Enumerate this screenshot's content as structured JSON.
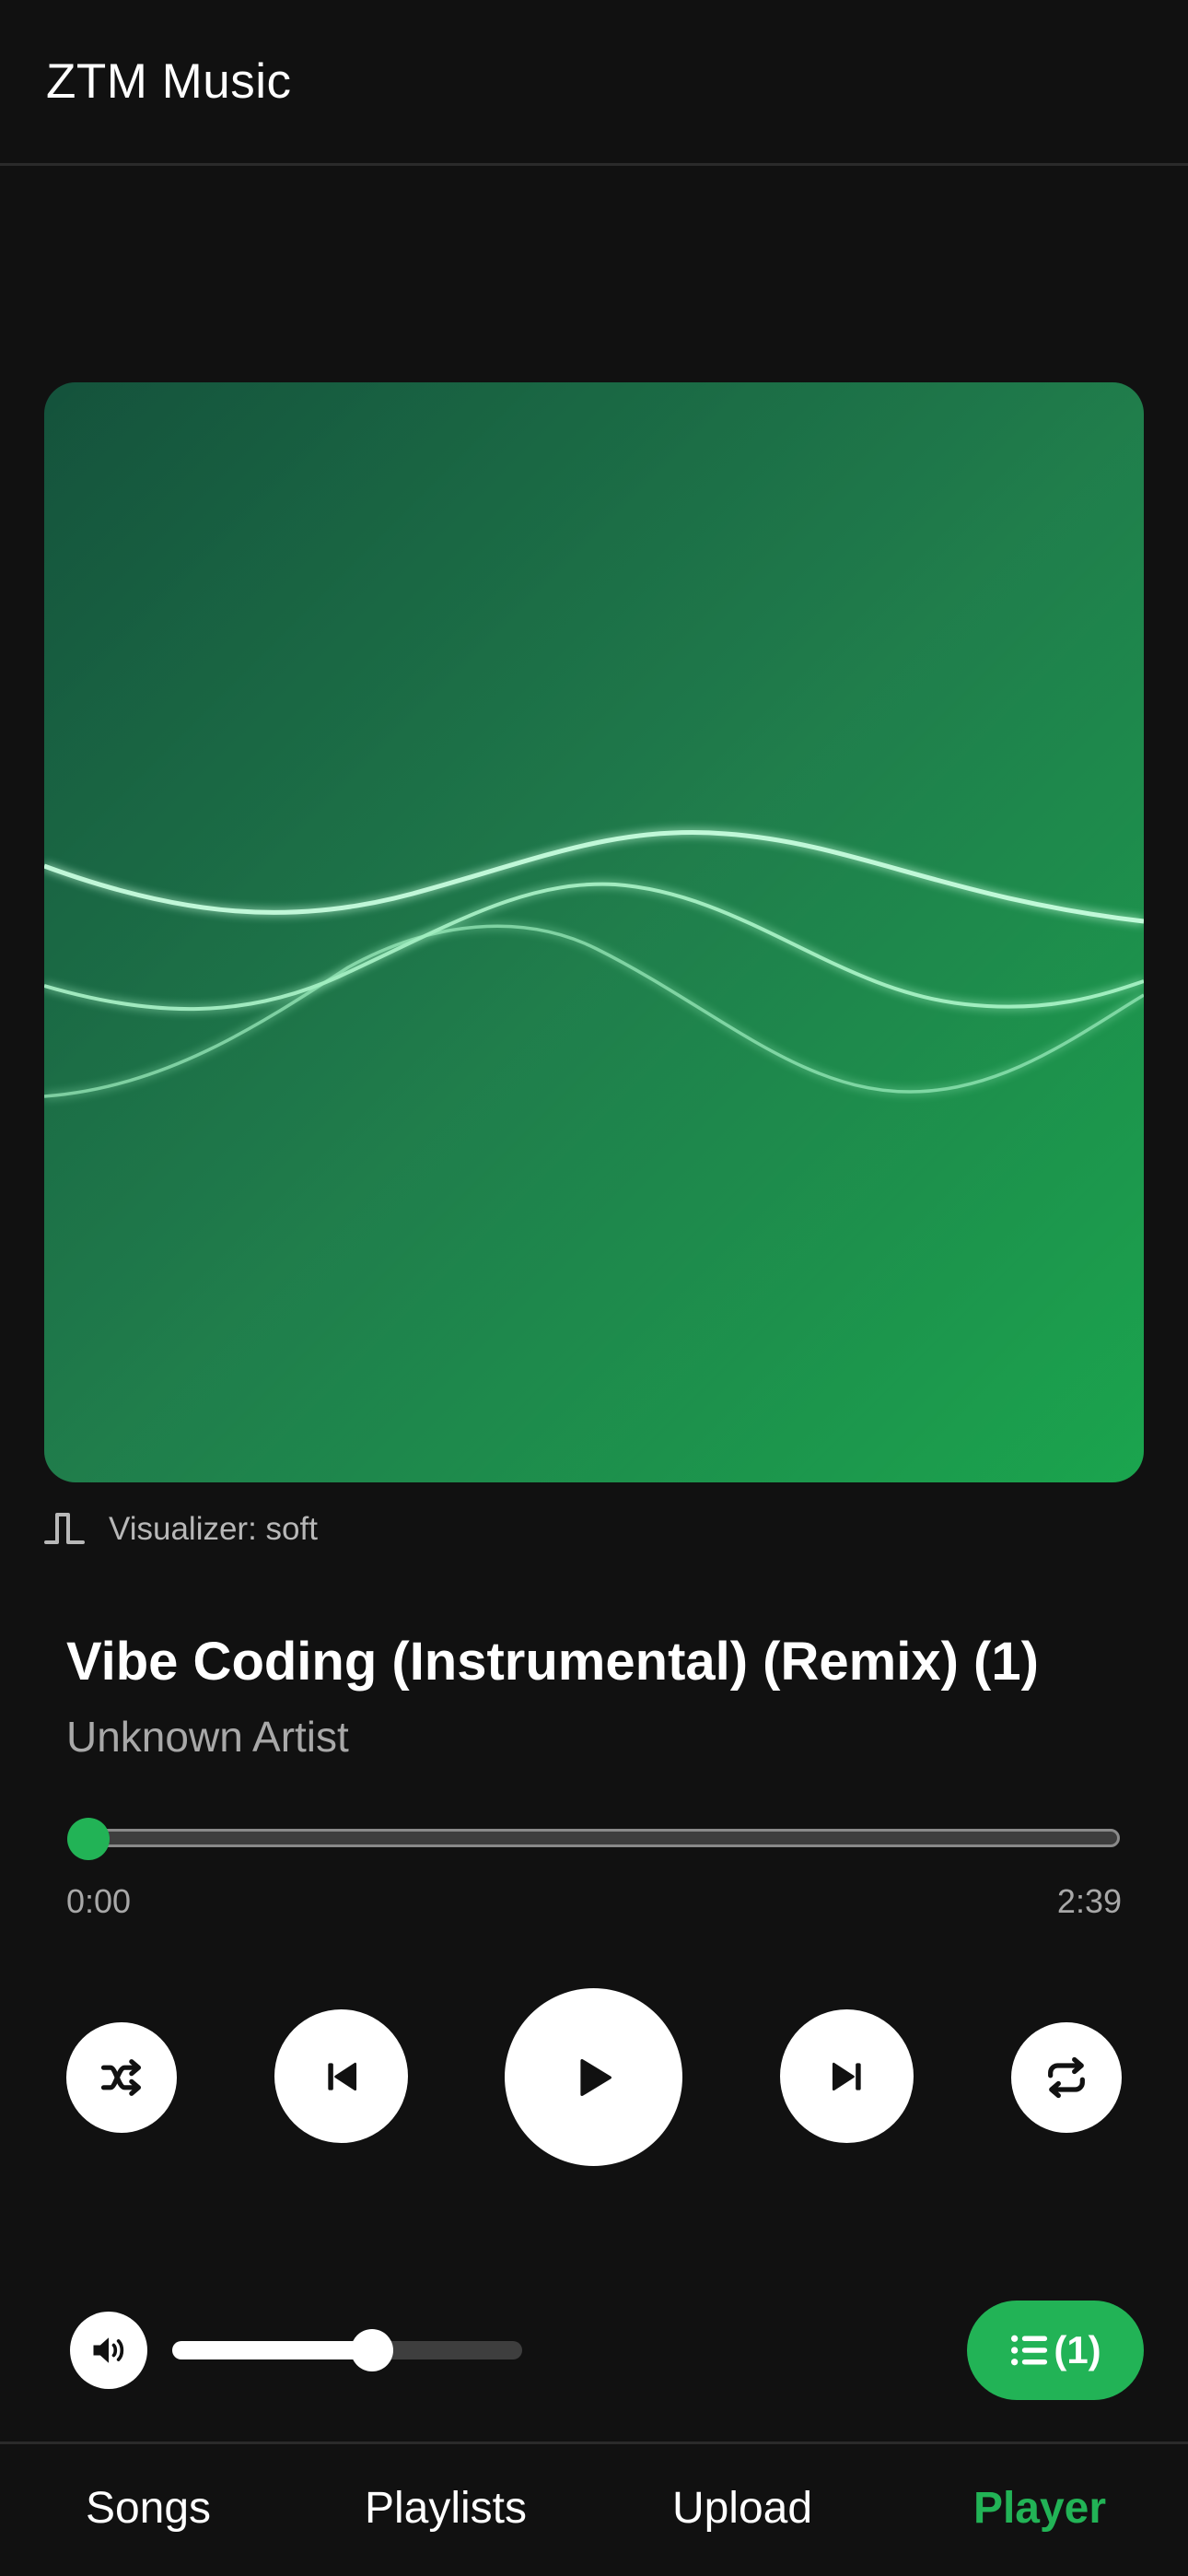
{
  "header": {
    "app_title": "ZTM Music"
  },
  "visualizer": {
    "label": "Visualizer: soft",
    "icon": "square-wave-icon"
  },
  "track": {
    "title": "Vibe Coding (Instrumental) (Remix) (1)",
    "artist": "Unknown Artist"
  },
  "progress": {
    "current_time": "0:00",
    "total_time": "2:39",
    "fraction": 0.0
  },
  "controls": {
    "shuffle_icon": "shuffle-icon",
    "previous_icon": "skip-previous-icon",
    "play_icon": "play-icon",
    "next_icon": "skip-next-icon",
    "repeat_icon": "repeat-icon"
  },
  "volume": {
    "icon": "speaker-icon",
    "level": 0.57
  },
  "queue": {
    "label": "(1)",
    "icon": "list-icon"
  },
  "nav": {
    "tabs": [
      {
        "label": "Songs",
        "active": false
      },
      {
        "label": "Playlists",
        "active": false
      },
      {
        "label": "Upload",
        "active": false
      },
      {
        "label": "Player",
        "active": true
      }
    ]
  },
  "colors": {
    "background": "#111111",
    "accent": "#22b356",
    "artwork_start": "#0d4d36",
    "artwork_end": "#16a34a",
    "secondary_text": "#a8a8a8"
  }
}
